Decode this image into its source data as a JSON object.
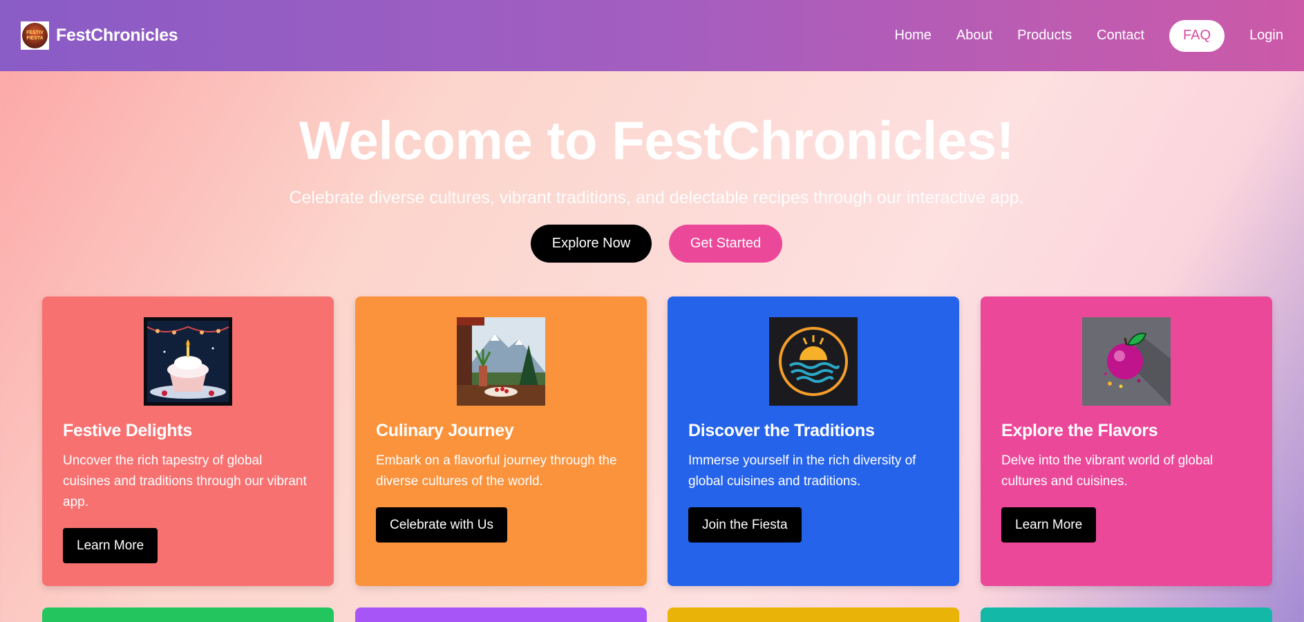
{
  "brand": {
    "name": "FestChronicles",
    "logo_text": "FESTIV FIESTA"
  },
  "nav": {
    "links": [
      "Home",
      "About",
      "Products",
      "Contact",
      "FAQ",
      "Login"
    ]
  },
  "hero": {
    "title": "Welcome to FestChronicles!",
    "subtitle": "Celebrate diverse cultures, vibrant traditions, and delectable recipes through our interactive app.",
    "primary_button": "Explore Now",
    "secondary_button": "Get Started"
  },
  "cards": [
    {
      "title": "Festive Delights",
      "text": "Uncover the rich tapestry of global cuisines and traditions through our vibrant app.",
      "button": "Learn More",
      "color": "#f87171",
      "image": "cupcake-image"
    },
    {
      "title": "Culinary Journey",
      "text": "Embark on a flavorful journey through the diverse cultures of the world.",
      "button": "Celebrate with Us",
      "color": "#fb923c",
      "image": "mountain-meal-image"
    },
    {
      "title": "Discover the Traditions",
      "text": "Immerse yourself in the rich diversity of global cuisines and traditions.",
      "button": "Join the Fiesta",
      "color": "#2563eb",
      "image": "sunset-emblem-image"
    },
    {
      "title": "Explore the Flavors",
      "text": "Delve into the vibrant world of global cultures and cuisines.",
      "button": "Learn More",
      "color": "#ec4899",
      "image": "plum-image"
    }
  ],
  "next_row_colors": [
    "#22c55e",
    "#a855f7",
    "#eab308",
    "#14b8a6"
  ]
}
